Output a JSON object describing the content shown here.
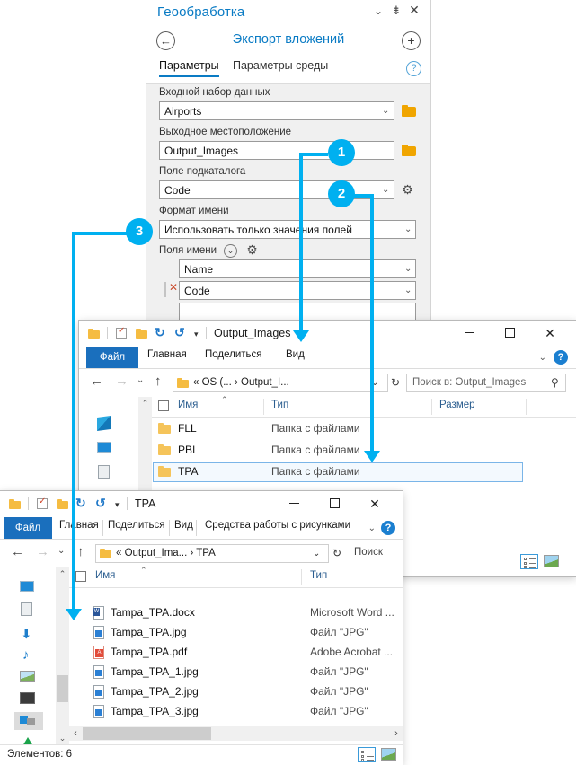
{
  "panel": {
    "title": "Геообработка",
    "tool_title": "Экспорт вложений",
    "tabs": [
      {
        "label": "Параметры",
        "active": true
      },
      {
        "label": "Параметры среды",
        "active": false
      }
    ],
    "icons": {
      "chevron": "chevron-down-icon",
      "pin": "pin-icon",
      "close": "close-icon",
      "back": "back-icon",
      "add": "add-icon",
      "help": "help-icon"
    },
    "fields": [
      {
        "label": "Входной набор данных",
        "value": "Airports",
        "has_dropdown": true,
        "has_browse": true
      },
      {
        "label": "Выходное местоположение",
        "value": "Output_Images",
        "has_dropdown": false,
        "has_browse": true
      },
      {
        "label": "Поле подкаталога",
        "value": "Code",
        "has_dropdown": true,
        "has_gear": true
      },
      {
        "label": "Формат имени",
        "value": "Использовать только значения полей",
        "has_dropdown": true
      }
    ],
    "name_fields": {
      "label": "Поля имени",
      "rows": [
        {
          "value": "Name",
          "removable": false
        },
        {
          "value": "Code",
          "removable": true
        },
        {
          "value": "",
          "removable": false
        }
      ]
    }
  },
  "window1": {
    "title": "Output_Images",
    "ribbon_tabs": [
      "Файл",
      "Главная",
      "Поделиться",
      "Вид"
    ],
    "address": "«  OS (...  ›  Output_I...",
    "search_placeholder": "Поиск в: Output_Images",
    "columns": [
      "Имя",
      "Тип",
      "Размер"
    ],
    "rows": [
      {
        "name": "FLL",
        "type": "Папка с файлами",
        "size": "",
        "icon": "folder-icon",
        "selected": false
      },
      {
        "name": "PBI",
        "type": "Папка с файлами",
        "size": "",
        "icon": "folder-icon",
        "selected": false
      },
      {
        "name": "TPA",
        "type": "Папка с файлами",
        "size": "",
        "icon": "folder-icon",
        "selected": true
      }
    ],
    "window_buttons": {
      "minimize": "—",
      "maximize": "☐",
      "close": "✕"
    }
  },
  "window2": {
    "title": "TPA",
    "ribbon_tabs": [
      "Файл",
      "Главная",
      "Поделиться",
      "Вид"
    ],
    "contextual_tab": "Средства работы с рисунками",
    "address": "«  Output_Ima...  ›  TPA",
    "search_placeholder": "Поиск",
    "columns": [
      "Имя",
      "Тип"
    ],
    "rows": [
      {
        "name": "Tampa_TPA.docx",
        "type": "Microsoft Word ...",
        "icon": "word-file-icon"
      },
      {
        "name": "Tampa_TPA.jpg",
        "type": "Файл \"JPG\"",
        "icon": "jpg-file-icon"
      },
      {
        "name": "Tampa_TPA.pdf",
        "type": "Adobe Acrobat ...",
        "icon": "pdf-file-icon"
      },
      {
        "name": "Tampa_TPA_1.jpg",
        "type": "Файл \"JPG\"",
        "icon": "jpg-file-icon"
      },
      {
        "name": "Tampa_TPA_2.jpg",
        "type": "Файл \"JPG\"",
        "icon": "jpg-file-icon"
      },
      {
        "name": "Tampa_TPA_3.jpg",
        "type": "Файл \"JPG\"",
        "icon": "jpg-file-icon"
      }
    ],
    "status": "Элементов: 6",
    "window_buttons": {
      "minimize": "—",
      "maximize": "☐",
      "close": "✕"
    }
  },
  "callouts": [
    {
      "number": "1"
    },
    {
      "number": "2"
    },
    {
      "number": "3"
    }
  ],
  "colors": {
    "callout": "#00b0f0",
    "accent": "#0a7bc4",
    "file_tab": "#1a6fbd",
    "folder": "#f5c45a"
  }
}
